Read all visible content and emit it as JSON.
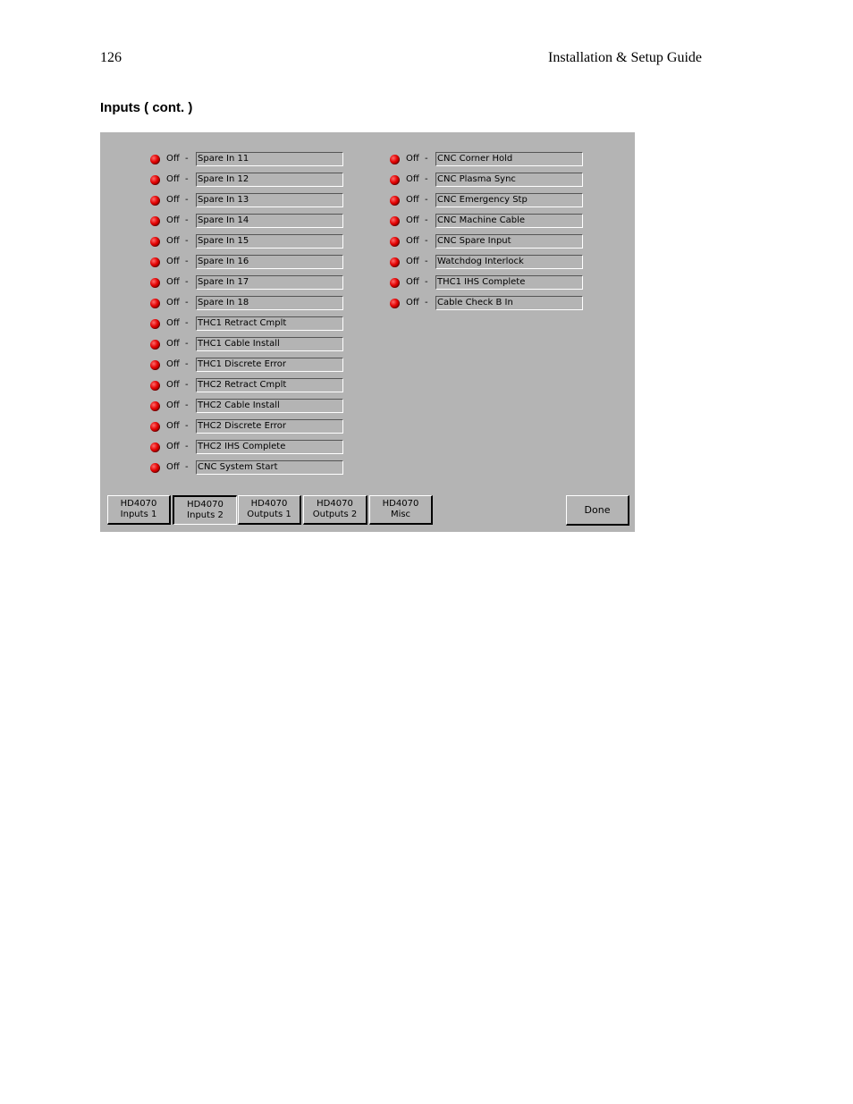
{
  "header": {
    "page_number": "126",
    "guide_title": "Installation & Setup Guide"
  },
  "section": {
    "title": "Inputs ( cont. )"
  },
  "colors": {
    "panel_bg": "#b4b4b4",
    "led_off": "#e00000"
  },
  "inputs_left": [
    {
      "state": "Off",
      "separator": "-",
      "name": "Spare In 11"
    },
    {
      "state": "Off",
      "separator": "-",
      "name": "Spare In 12"
    },
    {
      "state": "Off",
      "separator": "-",
      "name": "Spare In 13"
    },
    {
      "state": "Off",
      "separator": "-",
      "name": "Spare In 14"
    },
    {
      "state": "Off",
      "separator": "-",
      "name": "Spare In 15"
    },
    {
      "state": "Off",
      "separator": "-",
      "name": "Spare In 16"
    },
    {
      "state": "Off",
      "separator": "-",
      "name": "Spare In 17"
    },
    {
      "state": "Off",
      "separator": "-",
      "name": "Spare In 18"
    },
    {
      "state": "Off",
      "separator": "-",
      "name": "THC1 Retract Cmplt"
    },
    {
      "state": "Off",
      "separator": "-",
      "name": "THC1 Cable Install"
    },
    {
      "state": "Off",
      "separator": "-",
      "name": "THC1 Discrete Error"
    },
    {
      "state": "Off",
      "separator": "-",
      "name": "THC2 Retract Cmplt"
    },
    {
      "state": "Off",
      "separator": "-",
      "name": "THC2 Cable Install"
    },
    {
      "state": "Off",
      "separator": "-",
      "name": "THC2 Discrete Error"
    },
    {
      "state": "Off",
      "separator": "-",
      "name": "THC2 IHS Complete"
    },
    {
      "state": "Off",
      "separator": "-",
      "name": "CNC System Start"
    }
  ],
  "inputs_right": [
    {
      "state": "Off",
      "separator": "-",
      "name": "CNC Corner Hold"
    },
    {
      "state": "Off",
      "separator": "-",
      "name": "CNC Plasma Sync"
    },
    {
      "state": "Off",
      "separator": "-",
      "name": "CNC Emergency Stp"
    },
    {
      "state": "Off",
      "separator": "-",
      "name": "CNC Machine Cable"
    },
    {
      "state": "Off",
      "separator": "-",
      "name": "CNC Spare Input"
    },
    {
      "state": "Off",
      "separator": "-",
      "name": "Watchdog Interlock"
    },
    {
      "state": "Off",
      "separator": "-",
      "name": "THC1 IHS Complete"
    },
    {
      "state": "Off",
      "separator": "-",
      "name": "Cable Check B In"
    }
  ],
  "nav_tabs": [
    {
      "line1": "HD4070",
      "line2": "Inputs 1"
    },
    {
      "line1": "HD4070",
      "line2": "Inputs 2"
    },
    {
      "line1": "HD4070",
      "line2": "Outputs 1"
    },
    {
      "line1": "HD4070",
      "line2": "Outputs 2"
    },
    {
      "line1": "HD4070",
      "line2": "Misc"
    }
  ],
  "done_label": "Done"
}
